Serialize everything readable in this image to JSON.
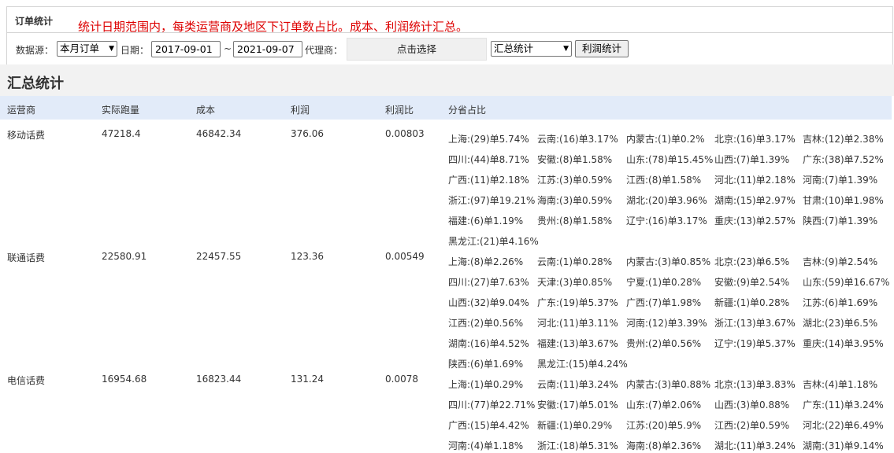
{
  "header": {
    "title": "订单统计",
    "description": "统计日期范围内，每类运营商及地区下订单数占比。成本、利润统计汇总。"
  },
  "toolbar": {
    "source_label": "数据源：",
    "source_value": "本月订单",
    "date_label": "日期：",
    "date_from": "2017-09-01",
    "date_sep": "~",
    "date_to": "2021-09-07",
    "agent_label": "代理商：",
    "agent_picker": "点击选择",
    "mode_value": "汇总统计",
    "profit_button": "利润统计"
  },
  "section": {
    "title": "汇总统计"
  },
  "table": {
    "columns": [
      "运营商",
      "实际跑量",
      "成本",
      "利润",
      "利润比",
      "分省占比"
    ],
    "rows": [
      {
        "carrier": "移动话费",
        "volume": "47218.4",
        "cost": "46842.34",
        "profit": "376.06",
        "ratio": "0.00803",
        "provinces": [
          "上海:(29)单5.74%",
          "云南:(16)单3.17%",
          "内蒙古:(1)单0.2%",
          "北京:(16)单3.17%",
          "吉林:(12)单2.38%",
          "四川:(44)单8.71%",
          "安徽:(8)单1.58%",
          "山东:(78)单15.45%",
          "山西:(7)单1.39%",
          "广东:(38)单7.52%",
          "广西:(11)单2.18%",
          "江苏:(3)单0.59%",
          "江西:(8)单1.58%",
          "河北:(11)单2.18%",
          "河南:(7)单1.39%",
          "浙江:(97)单19.21%",
          "海南:(3)单0.59%",
          "湖北:(20)单3.96%",
          "湖南:(15)单2.97%",
          "甘肃:(10)单1.98%",
          "福建:(6)单1.19%",
          "贵州:(8)单1.58%",
          "辽宁:(16)单3.17%",
          "重庆:(13)单2.57%",
          "陕西:(7)单1.39%",
          "黑龙江:(21)单4.16%"
        ]
      },
      {
        "carrier": "联通话费",
        "volume": "22580.91",
        "cost": "22457.55",
        "profit": "123.36",
        "ratio": "0.00549",
        "provinces": [
          "上海:(8)单2.26%",
          "云南:(1)单0.28%",
          "内蒙古:(3)单0.85%",
          "北京:(23)单6.5%",
          "吉林:(9)单2.54%",
          "四川:(27)单7.63%",
          "天津:(3)单0.85%",
          "宁夏:(1)单0.28%",
          "安徽:(9)单2.54%",
          "山东:(59)单16.67%",
          "山西:(32)单9.04%",
          "广东:(19)单5.37%",
          "广西:(7)单1.98%",
          "新疆:(1)单0.28%",
          "江苏:(6)单1.69%",
          "江西:(2)单0.56%",
          "河北:(11)单3.11%",
          "河南:(12)单3.39%",
          "浙江:(13)单3.67%",
          "湖北:(23)单6.5%",
          "湖南:(16)单4.52%",
          "福建:(13)单3.67%",
          "贵州:(2)单0.56%",
          "辽宁:(19)单5.37%",
          "重庆:(14)单3.95%",
          "陕西:(6)单1.69%",
          "黑龙江:(15)单4.24%"
        ]
      },
      {
        "carrier": "电信话费",
        "volume": "16954.68",
        "cost": "16823.44",
        "profit": "131.24",
        "ratio": "0.0078",
        "provinces": [
          "上海:(1)单0.29%",
          "云南:(11)单3.24%",
          "内蒙古:(3)单0.88%",
          "北京:(13)单3.83%",
          "吉林:(4)单1.18%",
          "四川:(77)单22.71%",
          "安徽:(17)单5.01%",
          "山东:(7)单2.06%",
          "山西:(3)单0.88%",
          "广东:(11)单3.24%",
          "广西:(15)单4.42%",
          "新疆:(1)单0.29%",
          "江苏:(20)单5.9%",
          "江西:(2)单0.59%",
          "河北:(22)单6.49%",
          "河南:(4)单1.18%",
          "浙江:(18)单5.31%",
          "海南:(8)单2.36%",
          "湖北:(11)单3.24%",
          "湖南:(31)单9.14%"
        ]
      }
    ]
  }
}
